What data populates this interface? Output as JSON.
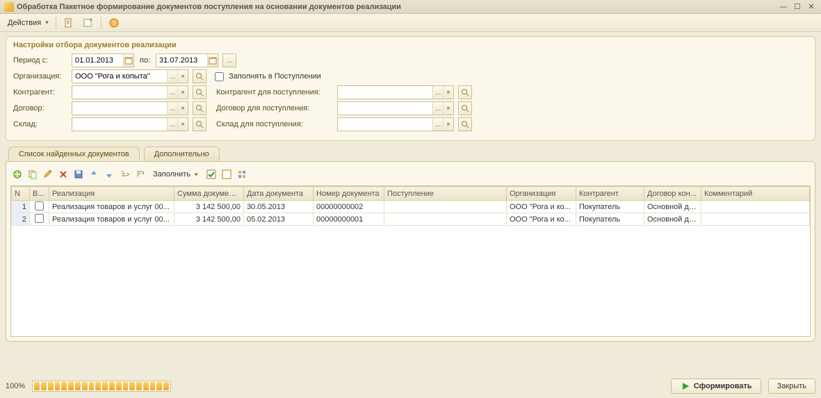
{
  "window": {
    "title": "Обработка  Пакетное формирование документов поступления на основании документов реализации"
  },
  "toolbar": {
    "actions": "Действия"
  },
  "group_title": "Настройки отбора документов реализации",
  "labels": {
    "period_from": "Период с:",
    "to": "по:",
    "org": "Организация:",
    "fill_checkbox": "Заполнять в Поступлении",
    "counterparty": "Контрагент:",
    "counterparty_receipt": "Контрагент для поступления:",
    "contract": "Договор:",
    "contract_receipt": "Договор для поступления:",
    "warehouse": "Склад:",
    "warehouse_receipt": "Склад для поступления:"
  },
  "values": {
    "date_from": "01.01.2013",
    "date_to": "31.07.2013",
    "org": "ООО \"Рога и копыта\"",
    "counterparty": "",
    "counterparty_receipt": "",
    "contract": "",
    "contract_receipt": "",
    "warehouse": "",
    "warehouse_receipt": ""
  },
  "tabs": {
    "tab1": "Список найденных документов",
    "tab2": "Дополнительно"
  },
  "list_toolbar": {
    "fill": "Заполнить"
  },
  "columns": {
    "n": "N",
    "v": "В...",
    "real": "Реализация",
    "sum": "Сумма документа",
    "date": "Дата документа",
    "docnum": "Номер документа",
    "receipt": "Поступление",
    "org": "Организация",
    "counterparty": "Контрагент",
    "contract": "Договор кон...",
    "comment": "Комментарий"
  },
  "rows": [
    {
      "n": "1",
      "real": "Реализация товаров и услуг 00...",
      "sum": "3 142 500,00",
      "date": "30.05.2013",
      "docnum": "00000000002",
      "receipt": "",
      "org": "ООО \"Рога и ко...",
      "counterparty": "Покупатель",
      "contract": "Основной до...",
      "comment": ""
    },
    {
      "n": "2",
      "real": "Реализация товаров и услуг 00...",
      "sum": "3 142 500,00",
      "date": "05.02.2013",
      "docnum": "00000000001",
      "receipt": "",
      "org": "ООО \"Рога и ко...",
      "counterparty": "Покупатель",
      "contract": "Основной до...",
      "comment": ""
    }
  ],
  "footer": {
    "progress": "100%",
    "form": "Сформировать",
    "close": "Закрыть"
  }
}
